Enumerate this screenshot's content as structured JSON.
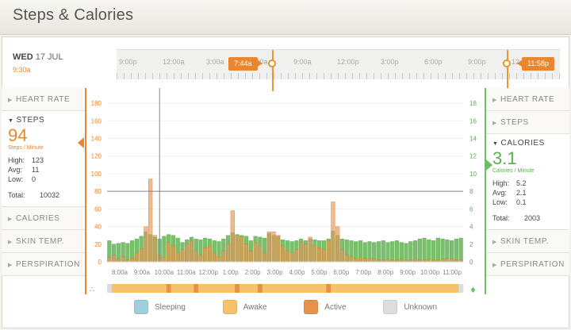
{
  "page": {
    "title": "Steps & Calories"
  },
  "date": {
    "day": "WED",
    "date": "17 JUL",
    "time": "9:30a"
  },
  "timeline": {
    "ticks": [
      "9:00p",
      "12:00a",
      "3:00a",
      "6:00a",
      "9:00a",
      "12:00p",
      "3:00p",
      "6:00p",
      "9:00p",
      "12:00a"
    ],
    "start_flag": "7:44a",
    "end_flag": "11:58p"
  },
  "left_menu": {
    "heart_rate": "HEART RATE",
    "steps": {
      "label": "STEPS",
      "value": "94",
      "unit": "Steps / Minute",
      "high_label": "High:",
      "high": "123",
      "avg_label": "Avg:",
      "avg": "11",
      "low_label": "Low:",
      "low": "0",
      "total_label": "Total:",
      "total": "10032"
    },
    "calories": "CALORIES",
    "skin_temp": "SKIN TEMP.",
    "perspiration": "PERSPIRATION"
  },
  "right_menu": {
    "heart_rate": "HEART RATE",
    "steps": "STEPS",
    "calories": {
      "label": "CALORIES",
      "value": "3.1",
      "unit": "Calories / Minute",
      "high_label": "High:",
      "high": "5.2",
      "avg_label": "Avg:",
      "avg": "2.1",
      "low_label": "Low:",
      "low": "0.1",
      "total_label": "Total:",
      "total": "2003"
    },
    "skin_temp": "SKIN TEMP.",
    "perspiration": "PERSPIRATION"
  },
  "legend": {
    "sleeping": "Sleeping",
    "awake": "Awake",
    "active": "Active",
    "unknown": "Unknown"
  },
  "colors": {
    "steps_accent": "#e8872f",
    "calories_accent": "#6cbf63",
    "sleeping": "#9fd0da",
    "awake": "#f6c26b",
    "active": "#e8914a",
    "unknown": "#dddddd",
    "bar_steps": "#e8964f",
    "bar_calories": "#79c06a"
  },
  "chart_data": {
    "type": "bar",
    "x_ticks": [
      "8:00a",
      "9:00a",
      "10:00a",
      "11:00a",
      "12:00p",
      "1:00p",
      "2:00p",
      "3:00p",
      "4:00p",
      "5:00p",
      "6:00p",
      "7:00p",
      "8:00p",
      "9:00p",
      "10:00p",
      "11:00p"
    ],
    "y_left_ticks": [
      "0",
      "20",
      "40",
      "60",
      "80",
      "100",
      "120",
      "140",
      "160",
      "180"
    ],
    "y_right_ticks": [
      "0",
      "2",
      "4",
      "6",
      "8",
      "10",
      "12",
      "14",
      "16",
      "18"
    ],
    "ylim_steps": [
      0,
      190
    ],
    "ylim_calories": [
      0,
      19
    ],
    "cursor_time": "9:30a",
    "cursor_steps": 80,
    "series": [
      {
        "name": "Steps",
        "values": [
          5,
          8,
          3,
          6,
          2,
          4,
          10,
          15,
          40,
          94,
          30,
          8,
          5,
          22,
          18,
          10,
          14,
          20,
          24,
          12,
          8,
          16,
          18,
          10,
          6,
          12,
          20,
          58,
          30,
          28,
          20,
          12,
          22,
          18,
          10,
          34,
          34,
          30,
          18,
          12,
          10,
          14,
          22,
          20,
          28,
          18,
          16,
          14,
          24,
          68,
          40,
          14,
          8,
          6,
          4,
          6,
          4,
          4,
          3,
          2,
          2,
          3,
          2,
          2,
          3,
          2,
          2,
          3,
          2,
          2,
          3,
          2,
          2,
          3,
          4,
          3,
          2,
          2
        ]
      },
      {
        "name": "Calories",
        "values": [
          2.4,
          2.0,
          2.1,
          2.2,
          2.1,
          2.4,
          2.6,
          2.9,
          3.4,
          3.1,
          2.8,
          2.6,
          2.9,
          3.1,
          3.0,
          2.7,
          2.2,
          2.5,
          2.8,
          2.6,
          2.5,
          2.7,
          2.6,
          2.4,
          2.3,
          2.6,
          3.0,
          3.3,
          3.1,
          3.0,
          2.9,
          2.4,
          2.9,
          2.8,
          2.7,
          3.2,
          3.0,
          2.9,
          2.5,
          2.4,
          2.3,
          2.4,
          2.6,
          2.4,
          2.6,
          2.5,
          2.4,
          2.4,
          2.6,
          3.5,
          3.0,
          2.6,
          2.5,
          2.4,
          2.3,
          2.4,
          2.2,
          2.3,
          2.2,
          2.3,
          2.4,
          2.2,
          2.3,
          2.4,
          2.2,
          2.1,
          2.3,
          2.4,
          2.6,
          2.7,
          2.5,
          2.4,
          2.7,
          2.6,
          2.5,
          2.4,
          2.6,
          2.7
        ]
      }
    ],
    "activity_states": [
      "unknown",
      "awake",
      "awake",
      "awake",
      "awake",
      "awake",
      "awake",
      "awake",
      "awake",
      "awake",
      "awake",
      "awake",
      "awake",
      "active",
      "awake",
      "awake",
      "awake",
      "awake",
      "awake",
      "active",
      "awake",
      "awake",
      "awake",
      "awake",
      "awake",
      "awake",
      "awake",
      "awake",
      "active",
      "awake",
      "awake",
      "awake",
      "awake",
      "active",
      "awake",
      "awake",
      "awake",
      "awake",
      "awake",
      "awake",
      "awake",
      "awake",
      "awake",
      "awake",
      "awake",
      "awake",
      "awake",
      "awake",
      "active",
      "awake",
      "awake",
      "awake",
      "awake",
      "awake",
      "awake",
      "awake",
      "awake",
      "awake",
      "awake",
      "awake",
      "awake",
      "awake",
      "awake",
      "awake",
      "awake",
      "awake",
      "awake",
      "awake",
      "awake",
      "awake",
      "awake",
      "awake",
      "awake",
      "awake",
      "awake",
      "awake",
      "awake",
      "unknown"
    ]
  }
}
